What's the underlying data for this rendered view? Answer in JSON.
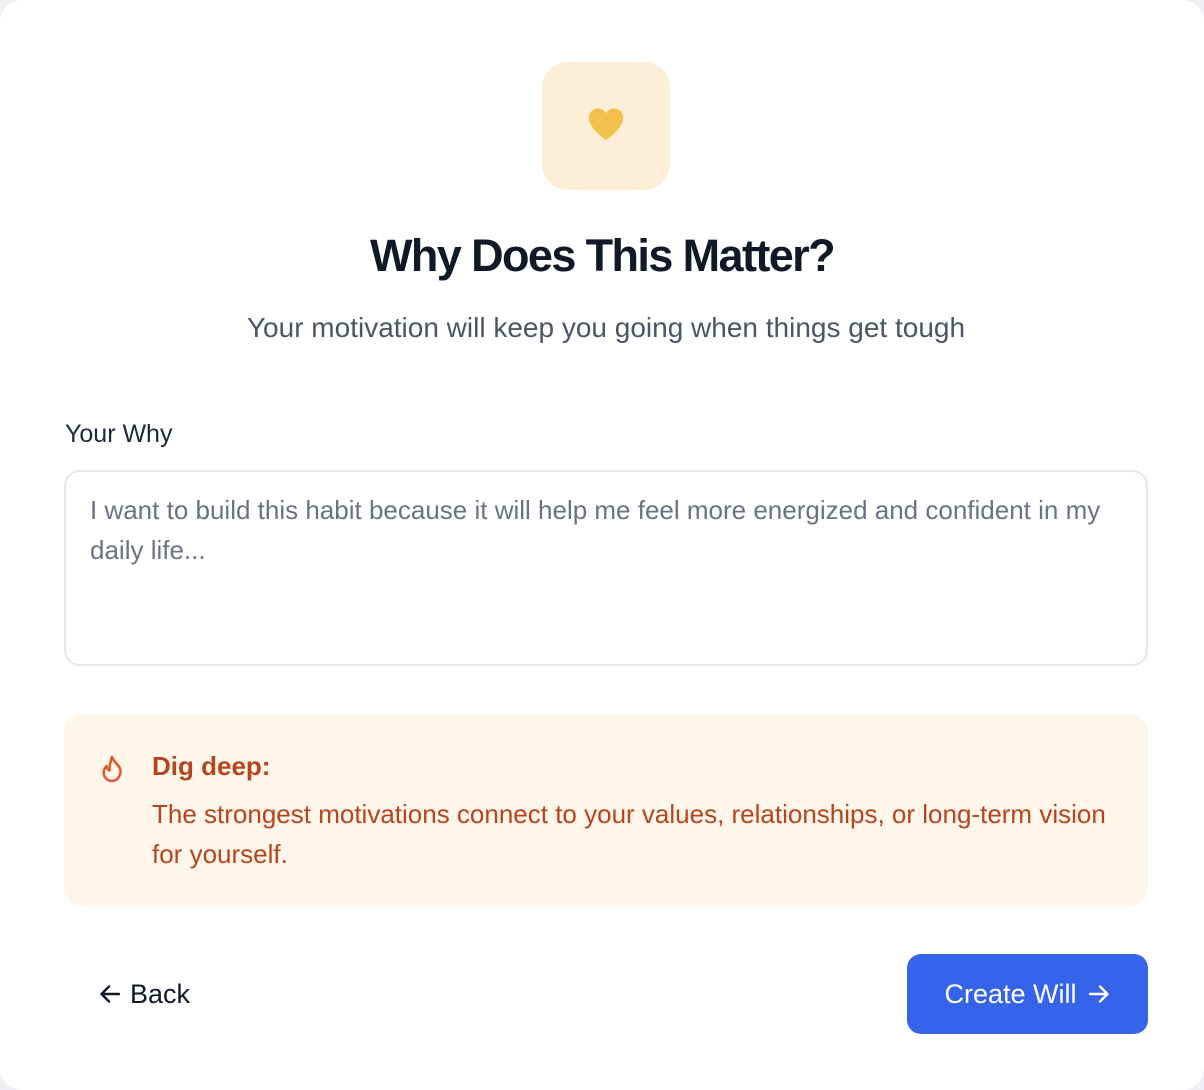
{
  "header": {
    "icon": "heart-icon",
    "title": "Why Does This Matter?",
    "subtitle": "Your motivation will keep you going when things get tough"
  },
  "form": {
    "label": "Your Why",
    "value": "",
    "placeholder": "I want to build this habit because it will help me feel more energized and confident in my daily life..."
  },
  "tip": {
    "icon": "flame-icon",
    "title": "Dig deep:",
    "text": "The strongest motivations connect to your values, relationships, or long-term vision for yourself."
  },
  "footer": {
    "back_label": "Back",
    "back_icon": "arrow-left-icon",
    "create_label": "Create Will",
    "create_icon": "arrow-right-icon"
  },
  "colors": {
    "accent": "#3563e9",
    "heart": "#f2c04b",
    "icon_bg": "#fdeed8",
    "tip_bg": "#fef5eb",
    "tip_text": "#b4451d"
  }
}
